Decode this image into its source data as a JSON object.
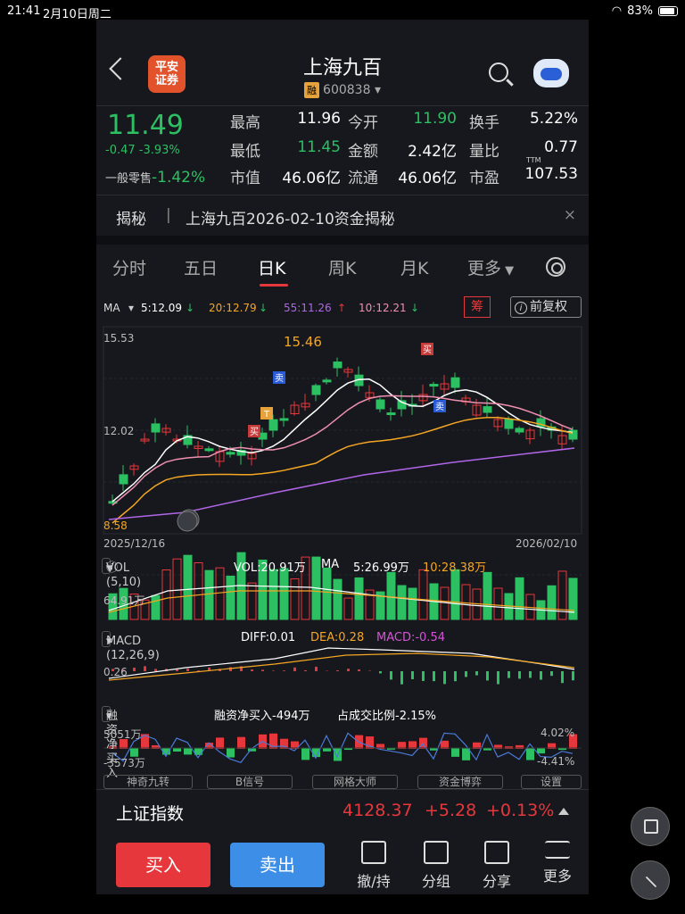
{
  "statusbar": {
    "time": "21:41",
    "date": "2月10日周二",
    "battery": "83%"
  },
  "header": {
    "logo_line1": "平安",
    "logo_line2": "证券",
    "title": "上海九百",
    "badge": "融",
    "code": "600838"
  },
  "quote": {
    "price": "11.49",
    "change": "-0.47 -3.93%",
    "retail_label": "一般零售",
    "retail_value": "-1.42%",
    "rows": [
      [
        {
          "l": "最高",
          "v": "11.96",
          "c": "w"
        },
        {
          "l": "今开",
          "v": "11.90",
          "c": "g"
        },
        {
          "l": "换手",
          "v": "5.22%",
          "c": "w"
        }
      ],
      [
        {
          "l": "最低",
          "v": "11.45",
          "c": "g"
        },
        {
          "l": "金额",
          "v": "2.42亿",
          "c": "w"
        },
        {
          "l": "量比",
          "v": "0.77",
          "c": "w"
        }
      ],
      [
        {
          "l": "市值",
          "v": "46.06亿",
          "c": "w"
        },
        {
          "l": "流通",
          "v": "46.06亿",
          "c": "w"
        },
        {
          "l": "市盈",
          "v": "107.53",
          "c": "w"
        }
      ]
    ],
    "ttm": "TTM"
  },
  "reveal": {
    "label": "揭秘",
    "text": "上海九百2026-02-10资金揭秘",
    "close": "×"
  },
  "tabs": [
    {
      "label": "分时"
    },
    {
      "label": "五日"
    },
    {
      "label": "日K"
    },
    {
      "label": "周K"
    },
    {
      "label": "月K"
    },
    {
      "label": "更多"
    }
  ],
  "ma": {
    "name": "MA",
    "ma5": "5:12.09",
    "ma20": "20:12.79",
    "ma55": "55:11.26",
    "ma10": "10:12.21",
    "chou": "筹",
    "fq": "前复权",
    "fq_icon": "i",
    "colors": {
      "ma5": "#ffffff",
      "ma20": "#f5a623",
      "ma55": "#b066e8",
      "ma10": "#f08fb0",
      "up": "#e6383c",
      "down": "#2cc062"
    }
  },
  "kline": {
    "ymax": "15.53",
    "ymid": "12.02",
    "ymin_label": "8.58",
    "peak": "15.46",
    "start_date": "2025/12/16",
    "end_date": "2026/02/10",
    "marks": {
      "sell": "卖",
      "buy": "买",
      "t": "T"
    }
  },
  "vol": {
    "name": "VOL (5,10)",
    "vol": "VOL:20.91万",
    "ma_label": "MA",
    "ma5": "5:26.99万",
    "ma10": "10:28.38万",
    "ylabel": "64.91万"
  },
  "macd": {
    "name": "MACD (12,26,9)",
    "diff": "DIFF:0.01",
    "dea": "DEA:0.28",
    "macd": "MACD:-0.54",
    "ylabel": "0.26"
  },
  "margin": {
    "name": "融资净买入",
    "text": "融资净买入-494万",
    "ratio": "占成交比例-2.15%",
    "ytop": "5051万",
    "ybot": "-3573万",
    "rtop": "4.02%",
    "rbot": "-4.41%"
  },
  "bottom_buttons": [
    {
      "label": "神奇九转"
    },
    {
      "label": "B信号"
    },
    {
      "label": "网格大师"
    },
    {
      "label": "资金博弈"
    },
    {
      "label": "设置"
    }
  ],
  "index": {
    "name": "上证指数",
    "value": "4128.37",
    "change": "+5.28",
    "pct": "+0.13%"
  },
  "trade": {
    "buy": "买入",
    "sell": "卖出"
  },
  "tools": [
    {
      "label": "撤/持"
    },
    {
      "label": "分组"
    },
    {
      "label": "分享"
    },
    {
      "label": "更多"
    }
  ]
}
